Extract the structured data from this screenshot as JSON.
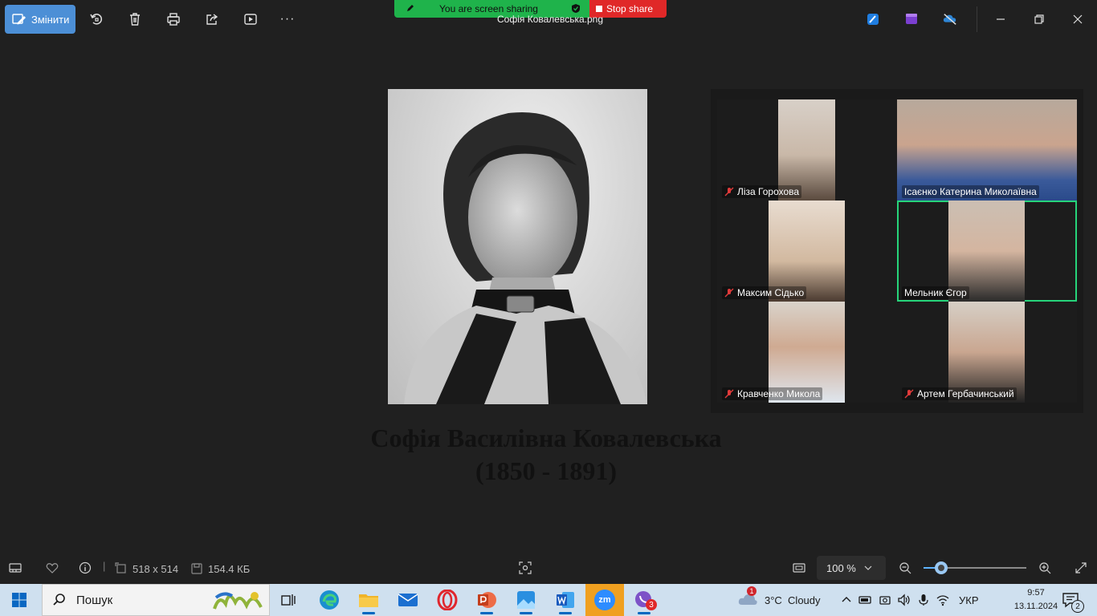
{
  "toolbar": {
    "edit_label": "Змінити",
    "more_label": "···"
  },
  "screen_share": {
    "status_text": "You are screen sharing",
    "stop_label": "Stop share",
    "green": "#1fb34b",
    "red": "#e02828"
  },
  "file_title": "Софія Ковалевська.png",
  "caption": {
    "line1": "Софія Василівна Ковалевська",
    "line2": "(1850 - 1891)"
  },
  "gallery": {
    "participants": [
      {
        "name": "Ліза Горохова",
        "muted": true,
        "active": false
      },
      {
        "name": "Ісаєнко Катерина Миколаївна",
        "muted": false,
        "active": false
      },
      {
        "name": "Максим Сідько",
        "muted": true,
        "active": false
      },
      {
        "name": "Мельник Єгор",
        "muted": false,
        "active": true
      },
      {
        "name": "Кравченко Микола",
        "muted": true,
        "active": false
      },
      {
        "name": "Артем Гербачинський",
        "muted": true,
        "active": false
      }
    ],
    "active_color": "#26d47a"
  },
  "statusbar": {
    "dimensions": "518 x 514",
    "file_size": "154.4 КБ",
    "zoom": "100 %",
    "zoom_fraction": 0.17
  },
  "taskbar": {
    "search_placeholder": "Пошук",
    "weather_badge": "1",
    "weather": "3°C  Cloudy",
    "language": "УКР",
    "time": "9:57",
    "date": "13.11.2024",
    "notifications": "2",
    "viber_badge": "3",
    "zoom_app_label": "zm"
  }
}
